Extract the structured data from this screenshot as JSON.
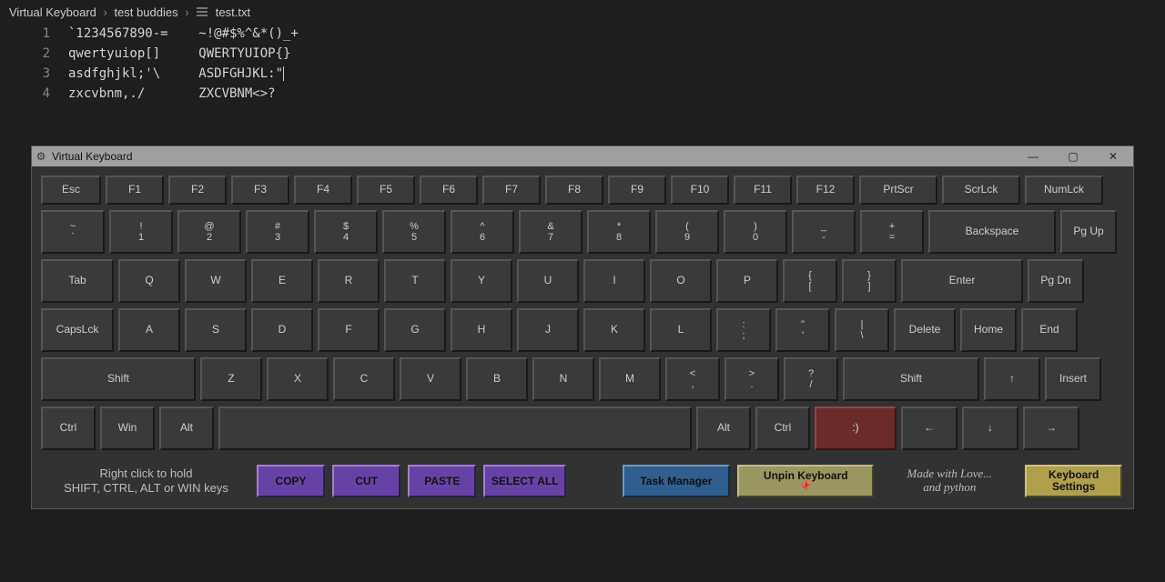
{
  "breadcrumb": {
    "a": "Virtual Keyboard",
    "b": "test buddies",
    "c": "test.txt",
    "sep": "›"
  },
  "lines": [
    {
      "n": "1",
      "t": "`1234567890-=    ~!@#$%^&*()_+"
    },
    {
      "n": "2",
      "t": "qwertyuiop[]     QWERTYUIOP{}"
    },
    {
      "n": "3",
      "t": "asdfghjkl;'\\     ASDFGHJKL:\""
    },
    {
      "n": "4",
      "t": "zxcvbnm,./       ZXCVBNM<>?"
    }
  ],
  "win": {
    "title": "Virtual Keyboard",
    "min": "—",
    "max": "▢",
    "close": "✕"
  },
  "row0": [
    "Esc",
    "F1",
    "F2",
    "F3",
    "F4",
    "F5",
    "F6",
    "F7",
    "F8",
    "F9",
    "F10",
    "F11",
    "F12",
    "PrtScr",
    "ScrLck",
    "NumLck"
  ],
  "row1": [
    {
      "u": "~",
      "l": "`"
    },
    {
      "u": "!",
      "l": "1"
    },
    {
      "u": "@",
      "l": "2"
    },
    {
      "u": "#",
      "l": "3"
    },
    {
      "u": "$",
      "l": "4"
    },
    {
      "u": "%",
      "l": "5"
    },
    {
      "u": "^",
      "l": "6"
    },
    {
      "u": "&",
      "l": "7"
    },
    {
      "u": "*",
      "l": "8"
    },
    {
      "u": "(",
      "l": "9"
    },
    {
      "u": ")",
      "l": "0"
    },
    {
      "u": "_",
      "l": "-"
    },
    {
      "u": "+",
      "l": "="
    }
  ],
  "row1extra": {
    "backspace": "Backspace",
    "pgup": "Pg Up"
  },
  "row2": {
    "tab": "Tab",
    "keys": [
      "Q",
      "W",
      "E",
      "R",
      "T",
      "Y",
      "U",
      "I",
      "O",
      "P"
    ],
    "brk1": {
      "u": "{",
      "l": "["
    },
    "brk2": {
      "u": "}",
      "l": "]"
    },
    "enter": "Enter",
    "pgdn": "Pg Dn"
  },
  "row3": {
    "caps": "CapsLck",
    "keys": [
      "A",
      "S",
      "D",
      "F",
      "G",
      "H",
      "J",
      "K",
      "L"
    ],
    "c1": {
      "u": ":",
      "l": ";"
    },
    "c2": {
      "u": "\"",
      "l": "'"
    },
    "c3": {
      "u": "|",
      "l": "\\"
    },
    "del": "Delete",
    "home": "Home",
    "end": "End"
  },
  "row4": {
    "shiftL": "Shift",
    "keys": [
      "Z",
      "X",
      "C",
      "V",
      "B",
      "N",
      "M"
    ],
    "c1": {
      "u": "<",
      "l": ","
    },
    "c2": {
      "u": ">",
      "l": "."
    },
    "c3": {
      "u": "?",
      "l": "/"
    },
    "shiftR": "Shift",
    "up": "↑",
    "ins": "Insert"
  },
  "row5": {
    "ctrlL": "Ctrl",
    "win": "Win",
    "altL": "Alt",
    "space": "",
    "altR": "Alt",
    "ctrlR": "Ctrl",
    "smiley": ":)",
    "left": "←",
    "down": "↓",
    "right": "→"
  },
  "footer": {
    "hint1": "Right click to hold",
    "hint2": "SHIFT, CTRL, ALT or WIN keys",
    "copy": "COPY",
    "cut": "CUT",
    "paste": "PASTE",
    "selall": "SELECT ALL",
    "taskmgr": "Task Manager",
    "unpin1": "Unpin Keyboard",
    "unpin2": "📌",
    "credit1": "Made with Love...",
    "credit2": "and python",
    "settings1": "Keyboard",
    "settings2": "Settings"
  }
}
